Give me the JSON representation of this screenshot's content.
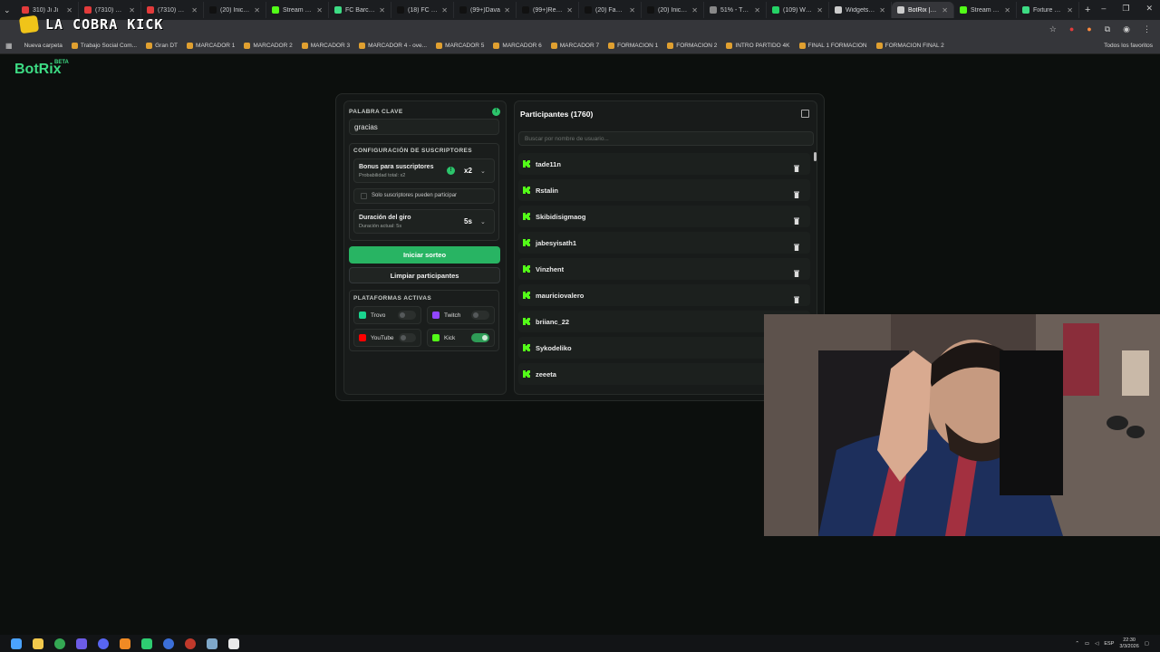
{
  "browser": {
    "tabs": [
      {
        "title": "310) Ji Ji",
        "color": "#e23b3b",
        "icon": "record-icon"
      },
      {
        "title": "(7310) Marc",
        "color": "#e23b3b",
        "icon": "youtube-icon"
      },
      {
        "title": "(7310) BARC",
        "color": "#e23b3b",
        "icon": "youtube-icon"
      },
      {
        "title": "(20) Inicio /",
        "color": "#111111",
        "icon": "x-icon"
      },
      {
        "title": "Stream - Ki",
        "color": "#53fc18",
        "icon": "kick-icon"
      },
      {
        "title": "FC Barcelon",
        "color": "#3ddc84",
        "icon": "botrix-icon"
      },
      {
        "title": "(18) FC Barc",
        "color": "#111111",
        "icon": "x-icon"
      },
      {
        "title": "(99+)Dava",
        "color": "#111111",
        "icon": "tiktok-icon"
      },
      {
        "title": "(99+)Reaco",
        "color": "#111111",
        "icon": "tiktok-icon"
      },
      {
        "title": "(20) Fabrizi",
        "color": "#111111",
        "icon": "x-icon"
      },
      {
        "title": "(20) Inicio /",
        "color": "#111111",
        "icon": "x-icon"
      },
      {
        "title": "51% - Trans",
        "color": "#888888",
        "icon": "page-icon"
      },
      {
        "title": "(109) Whats",
        "color": "#25d366",
        "icon": "whatsapp-icon"
      },
      {
        "title": "Widgets | B",
        "color": "#cccccc",
        "icon": "botrix-icon"
      },
      {
        "title": "BotRix | Soi",
        "color": "#cccccc",
        "icon": "botrix-icon",
        "active": true
      },
      {
        "title": "Stream - Ki",
        "color": "#53fc18",
        "icon": "kick-icon"
      },
      {
        "title": "Fixture y pa",
        "color": "#3ddc84",
        "icon": "page-icon"
      }
    ],
    "bookmarks": [
      "Nueva carpeta",
      "Trabajo Social Com...",
      "Gran DT",
      "MARCADOR 1",
      "MARCADOR 2",
      "MARCADOR 3",
      "MARCADOR 4 - ove...",
      "MARCADOR 5",
      "MARCADOR 6",
      "MARCADOR 7",
      "FORMACION 1",
      "FORMACION 2",
      "INTRO PARTIDO 4K",
      "FINAL 1 FORMACION",
      "FORMACION FINAL 2"
    ],
    "all_bookmarks": "Todos los favoritos"
  },
  "overlay_logo": "LA COBRA KICK",
  "app": {
    "brand": "BotRix",
    "beta": "BETA"
  },
  "keyword": {
    "label": "PALABRA CLAVE",
    "value": "gracias"
  },
  "subs": {
    "title": "CONFIGURACIÓN DE SUSCRIPTORES",
    "bonus_label": "Bonus para suscriptores",
    "bonus_sub": "Probabilidad total: x2",
    "bonus_value": "x2",
    "only_subs": "Solo suscriptores pueden participar",
    "duration_label": "Duración del giro",
    "duration_sub": "Duración actual: 5s",
    "duration_value": "5s"
  },
  "actions": {
    "start": "Iniciar sorteo",
    "clear": "Limpiar participantes"
  },
  "platforms": {
    "title": "PLATAFORMAS ACTIVAS",
    "items": [
      {
        "name": "Trovo",
        "color": "#1ad58f",
        "enabled": false
      },
      {
        "name": "Twitch",
        "color": "#9146ff",
        "enabled": false
      },
      {
        "name": "YouTube",
        "color": "#ff0000",
        "enabled": false
      },
      {
        "name": "Kick",
        "color": "#53fc18",
        "enabled": true
      }
    ]
  },
  "participants": {
    "title": "Participantes (1760)",
    "search_placeholder": "Buscar por nombre de usuario...",
    "list": [
      "tade11n",
      "Rstalin",
      "Skibidisigmaog",
      "jabesyisath1",
      "Vinzhent",
      "mauriciovalero",
      "briianc_22",
      "Sykodeliko",
      "zeeeta"
    ]
  },
  "tray": {
    "lang": "ESP",
    "time": "22:30",
    "date": "3/3/2026"
  },
  "colors": {
    "accent": "#2cc46b",
    "kick": "#53fc18"
  }
}
